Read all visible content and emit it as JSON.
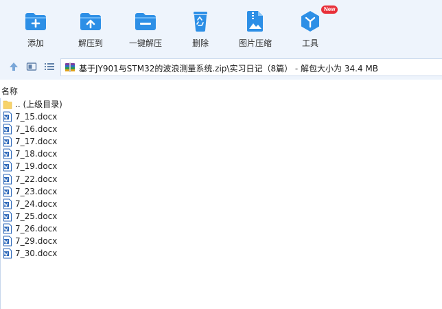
{
  "toolbar": {
    "items": [
      {
        "label": "添加",
        "icon": "add-folder-icon"
      },
      {
        "label": "解压到",
        "icon": "extract-to-icon"
      },
      {
        "label": "一键解压",
        "icon": "one-click-extract-icon"
      },
      {
        "label": "删除",
        "icon": "recycle-bin-icon"
      },
      {
        "label": "图片压缩",
        "icon": "image-compress-icon"
      },
      {
        "label": "工具",
        "icon": "tools-icon",
        "badge": "New"
      }
    ]
  },
  "address": {
    "path": "基于JY901与STM32的波浪测量系统.zip\\实习日记（8篇）",
    "info": " - 解包大小为 34.4 MB"
  },
  "list": {
    "column_name": "名称",
    "parent": ".. (上级目录)",
    "files": [
      "7_15.docx",
      "7_16.docx",
      "7_17.docx",
      "7_18.docx",
      "7_19.docx",
      "7_22.docx",
      "7_23.docx",
      "7_24.docx",
      "7_25.docx",
      "7_26.docx",
      "7_29.docx",
      "7_30.docx"
    ]
  },
  "colors": {
    "accent": "#2d8fe6",
    "badge": "#e8303a",
    "toolbar_bg": "#eef4fc"
  }
}
